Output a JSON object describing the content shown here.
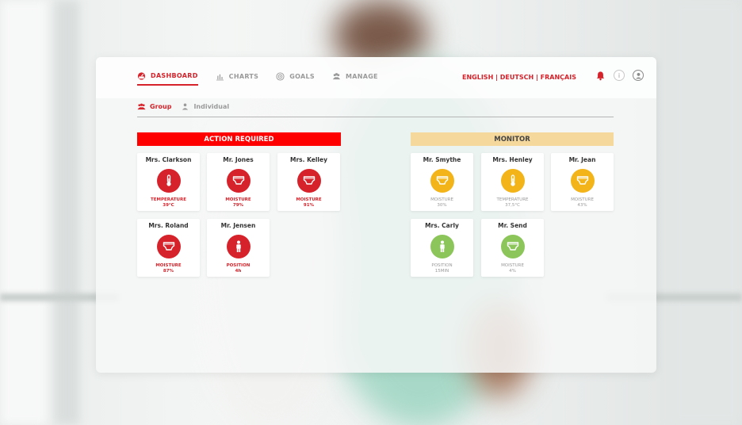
{
  "nav": {
    "dashboard": "DASHBOARD",
    "charts": "CHARTS",
    "goals": "GOALS",
    "manage": "MANAGE"
  },
  "languages": {
    "english": "ENGLISH",
    "deutsch": "DEUTSCH",
    "francais": "FRANÇAIS",
    "separator": " | "
  },
  "top_icons": {
    "notification": "bell-icon",
    "info": "info-icon",
    "user": "user-icon",
    "info_glyph": "i"
  },
  "subtabs": {
    "group": "Group",
    "individual": "Individual"
  },
  "action_required": {
    "title": "ACTION REQUIRED",
    "color": "#ff0000",
    "patients": [
      {
        "name": "Mrs. Clarkson",
        "icon": "thermometer-icon",
        "metric": "TEMPERATURE",
        "value": "39°C"
      },
      {
        "name": "Mr. Jones",
        "icon": "diaper-icon",
        "metric": "MOISTURE",
        "value": "79%"
      },
      {
        "name": "Mrs. Kelley",
        "icon": "diaper-icon",
        "metric": "MOISTURE",
        "value": "91%"
      },
      {
        "name": "Mrs. Roland",
        "icon": "diaper-icon",
        "metric": "MOISTURE",
        "value": "87%"
      },
      {
        "name": "Mr. Jensen",
        "icon": "person-icon",
        "metric": "POSITION",
        "value": "4h"
      }
    ]
  },
  "monitor": {
    "title": "MONITOR",
    "color": "#f5d89c",
    "patients": [
      {
        "name": "Mr. Smythe",
        "icon": "diaper-icon",
        "metric": "MOISTURE",
        "value": "30%",
        "status": "yellow"
      },
      {
        "name": "Mrs. Henley",
        "icon": "thermometer-icon",
        "metric": "TEMPERATURE",
        "value": "37,5°C",
        "status": "yellow"
      },
      {
        "name": "Mr. Jean",
        "icon": "diaper-icon",
        "metric": "MOISTURE",
        "value": "43%",
        "status": "yellow"
      },
      {
        "name": "Mrs. Carly",
        "icon": "person-icon",
        "metric": "POSITION",
        "value": "15MIN",
        "status": "green"
      },
      {
        "name": "Mr. Send",
        "icon": "diaper-icon",
        "metric": "MOISTURE",
        "value": "4%",
        "status": "green"
      }
    ]
  },
  "colors": {
    "accent_red": "#d6222a",
    "alert_yellow": "#f2b418",
    "ok_green": "#8cc65a"
  }
}
